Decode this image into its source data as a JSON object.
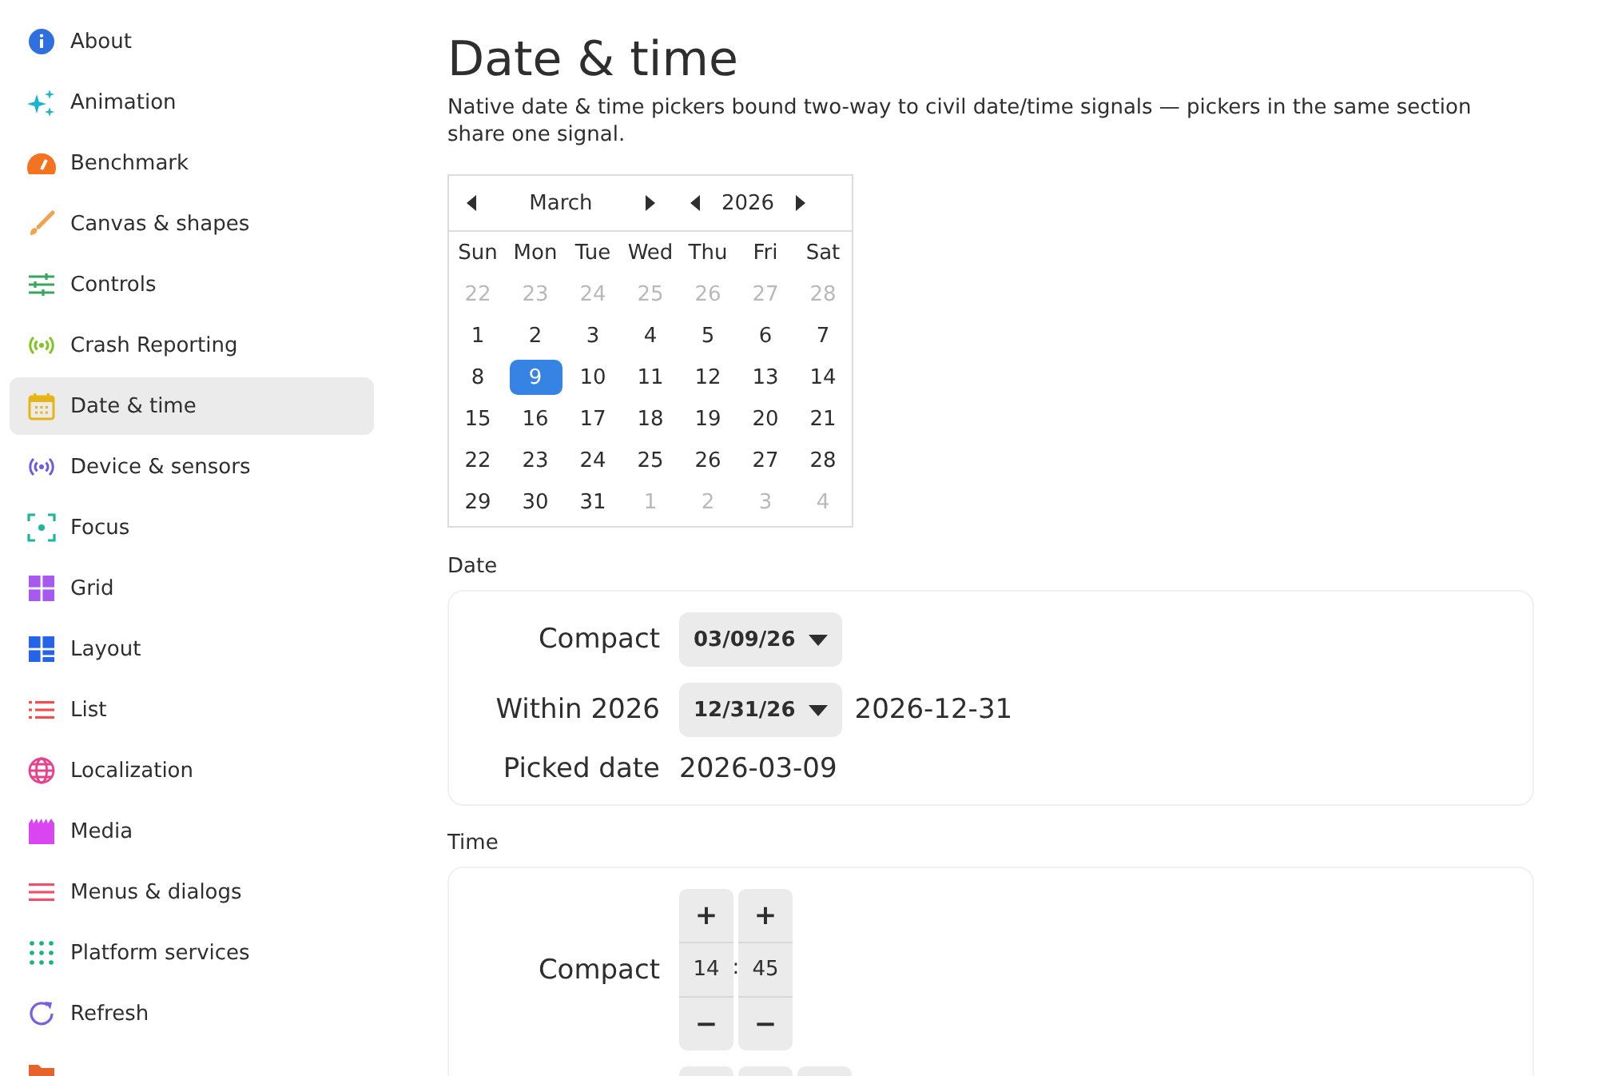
{
  "sidebar": {
    "items": [
      {
        "label": "About",
        "selected": false
      },
      {
        "label": "Animation",
        "selected": false
      },
      {
        "label": "Benchmark",
        "selected": false
      },
      {
        "label": "Canvas & shapes",
        "selected": false
      },
      {
        "label": "Controls",
        "selected": false
      },
      {
        "label": "Crash Reporting",
        "selected": false
      },
      {
        "label": "Date & time",
        "selected": true
      },
      {
        "label": "Device & sensors",
        "selected": false
      },
      {
        "label": "Focus",
        "selected": false
      },
      {
        "label": "Grid",
        "selected": false
      },
      {
        "label": "Layout",
        "selected": false
      },
      {
        "label": "List",
        "selected": false
      },
      {
        "label": "Localization",
        "selected": false
      },
      {
        "label": "Media",
        "selected": false
      },
      {
        "label": "Menus & dialogs",
        "selected": false
      },
      {
        "label": "Platform services",
        "selected": false
      },
      {
        "label": "Refresh",
        "selected": false
      },
      {
        "selected": false
      }
    ]
  },
  "page": {
    "title": "Date & time",
    "description": "Native date & time pickers bound two-way to civil date/time signals — pickers in the same section share one signal."
  },
  "calendar": {
    "month": "March",
    "year": "2026",
    "weekdays": [
      "Sun",
      "Mon",
      "Tue",
      "Wed",
      "Thu",
      "Fri",
      "Sat"
    ],
    "weeks": [
      [
        {
          "label": "22",
          "in_month": false,
          "selected": false
        },
        {
          "label": "23",
          "in_month": false,
          "selected": false
        },
        {
          "label": "24",
          "in_month": false,
          "selected": false
        },
        {
          "label": "25",
          "in_month": false,
          "selected": false
        },
        {
          "label": "26",
          "in_month": false,
          "selected": false
        },
        {
          "label": "27",
          "in_month": false,
          "selected": false
        },
        {
          "label": "28",
          "in_month": false,
          "selected": false
        }
      ],
      [
        {
          "label": "1",
          "in_month": true,
          "selected": false
        },
        {
          "label": "2",
          "in_month": true,
          "selected": false
        },
        {
          "label": "3",
          "in_month": true,
          "selected": false
        },
        {
          "label": "4",
          "in_month": true,
          "selected": false
        },
        {
          "label": "5",
          "in_month": true,
          "selected": false
        },
        {
          "label": "6",
          "in_month": true,
          "selected": false
        },
        {
          "label": "7",
          "in_month": true,
          "selected": false
        }
      ],
      [
        {
          "label": "8",
          "in_month": true,
          "selected": false
        },
        {
          "label": "9",
          "in_month": true,
          "selected": true
        },
        {
          "label": "10",
          "in_month": true,
          "selected": false
        },
        {
          "label": "11",
          "in_month": true,
          "selected": false
        },
        {
          "label": "12",
          "in_month": true,
          "selected": false
        },
        {
          "label": "13",
          "in_month": true,
          "selected": false
        },
        {
          "label": "14",
          "in_month": true,
          "selected": false
        }
      ],
      [
        {
          "label": "15",
          "in_month": true,
          "selected": false
        },
        {
          "label": "16",
          "in_month": true,
          "selected": false
        },
        {
          "label": "17",
          "in_month": true,
          "selected": false
        },
        {
          "label": "18",
          "in_month": true,
          "selected": false
        },
        {
          "label": "19",
          "in_month": true,
          "selected": false
        },
        {
          "label": "20",
          "in_month": true,
          "selected": false
        },
        {
          "label": "21",
          "in_month": true,
          "selected": false
        }
      ],
      [
        {
          "label": "22",
          "in_month": true,
          "selected": false
        },
        {
          "label": "23",
          "in_month": true,
          "selected": false
        },
        {
          "label": "24",
          "in_month": true,
          "selected": false
        },
        {
          "label": "25",
          "in_month": true,
          "selected": false
        },
        {
          "label": "26",
          "in_month": true,
          "selected": false
        },
        {
          "label": "27",
          "in_month": true,
          "selected": false
        },
        {
          "label": "28",
          "in_month": true,
          "selected": false
        }
      ],
      [
        {
          "label": "29",
          "in_month": true,
          "selected": false
        },
        {
          "label": "30",
          "in_month": true,
          "selected": false
        },
        {
          "label": "31",
          "in_month": true,
          "selected": false
        },
        {
          "label": "1",
          "in_month": false,
          "selected": false
        },
        {
          "label": "2",
          "in_month": false,
          "selected": false
        },
        {
          "label": "3",
          "in_month": false,
          "selected": false
        },
        {
          "label": "4",
          "in_month": false,
          "selected": false
        }
      ]
    ]
  },
  "sections": [
    {
      "label": "Date",
      "rows": [
        {
          "kind": "picker",
          "label": "Compact",
          "value": "03/09/26"
        },
        {
          "kind": "picker",
          "label": "Within 2026",
          "value": "12/31/26",
          "readout": "2026-12-31"
        },
        {
          "kind": "text",
          "label": "Picked date",
          "value": "2026-03-09"
        }
      ]
    },
    {
      "label": "Time",
      "rows": [
        {
          "kind": "stepper",
          "label": "Compact",
          "separator": ":",
          "columns": [
            {
              "kind": "full",
              "up": "+",
              "value": "14",
              "down": "−"
            },
            {
              "kind": "full",
              "up": "+",
              "value": "45",
              "down": "−"
            }
          ]
        },
        {
          "kind": "stepper",
          "columns": [
            {
              "kind": "cut"
            },
            {
              "kind": "cut"
            },
            {
              "kind": "cut"
            }
          ]
        }
      ]
    }
  ]
}
